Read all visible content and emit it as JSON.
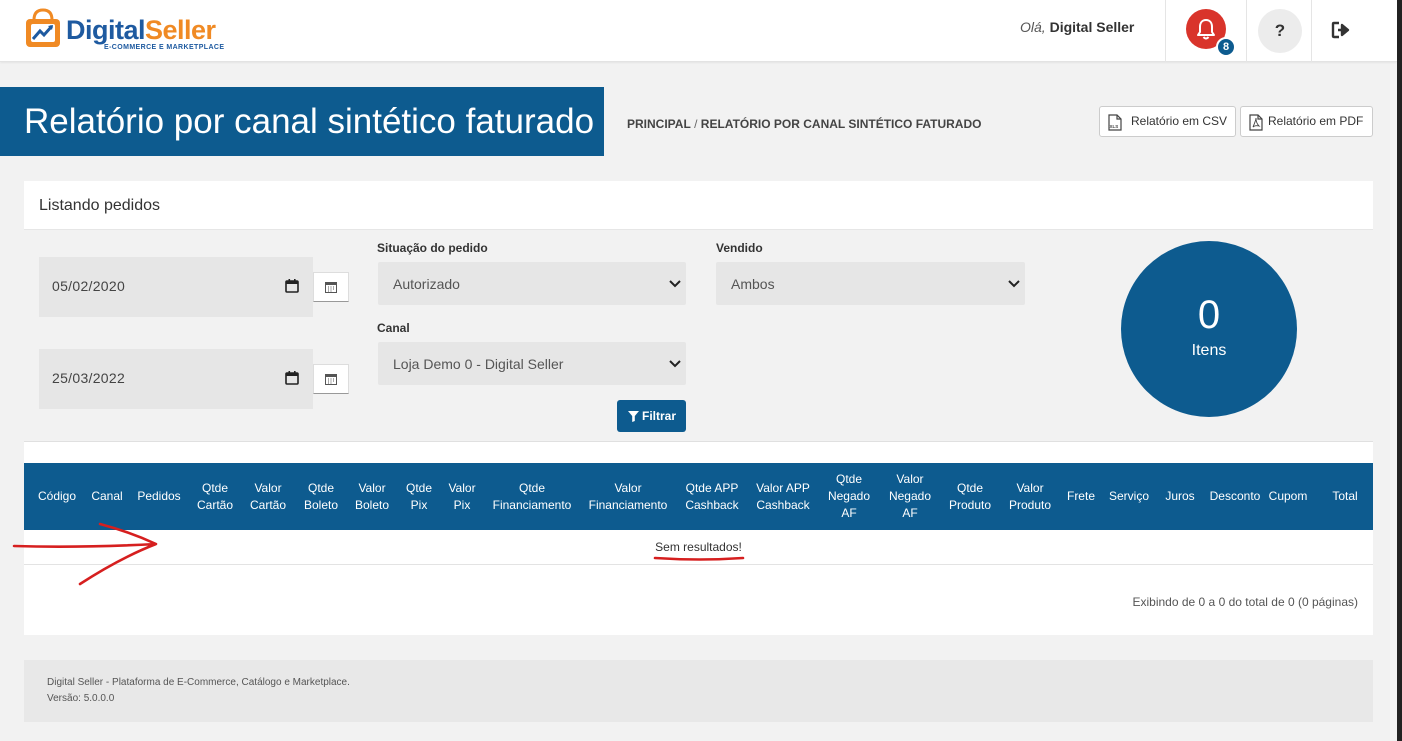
{
  "header": {
    "brand_part1": "Digital",
    "brand_part2": "Seller",
    "brand_tagline": "E-COMMERCE E MARKETPLACE",
    "greeting_prefix": "Olá,",
    "greeting_name": "Digital Seller",
    "notifications_count": "8",
    "help_label": "?"
  },
  "page": {
    "title": "Relatório por canal sintético faturado",
    "breadcrumb_home": "PRINCIPAL",
    "breadcrumb_sep": " / ",
    "breadcrumb_current": "RELATÓRIO POR CANAL SINTÉTICO FATURADO",
    "btn_csv": "Relatório em CSV",
    "btn_pdf": "Relatório em PDF",
    "csv_icon_text": "XLS"
  },
  "card": {
    "title": "Listando pedidos"
  },
  "filters": {
    "date_start": "05/02/2020",
    "date_end": "25/03/2022",
    "status_label": "Situação do pedido",
    "status_value": "Autorizado",
    "sold_label": "Vendido",
    "sold_value": "Ambos",
    "channel_label": "Canal",
    "channel_value": "Loja Demo 0 - Digital Seller",
    "filter_button": "Filtrar"
  },
  "summary": {
    "count": "0",
    "label": "Itens"
  },
  "table": {
    "columns": [
      [
        "Código"
      ],
      [
        "Canal"
      ],
      [
        "Pedidos"
      ],
      [
        "Qtde",
        "Cartão"
      ],
      [
        "Valor",
        "Cartão"
      ],
      [
        "Qtde",
        "Boleto"
      ],
      [
        "Valor",
        "Boleto"
      ],
      [
        "Qtde",
        "Pix"
      ],
      [
        "Valor",
        "Pix"
      ],
      [
        "Qtde",
        "Financiamento"
      ],
      [
        "Valor",
        "Financiamento"
      ],
      [
        "Qtde APP",
        "Cashback"
      ],
      [
        "Valor APP",
        "Cashback"
      ],
      [
        "Qtde",
        "Negado",
        "AF"
      ],
      [
        "Valor",
        "Negado",
        "AF"
      ],
      [
        "Qtde",
        "Produto"
      ],
      [
        "Valor",
        "Produto"
      ],
      [
        "Frete"
      ],
      [
        "Serviço"
      ],
      [
        "Juros"
      ],
      [
        "Desconto"
      ],
      [
        "Cupom"
      ],
      [
        "Total"
      ]
    ],
    "empty_message": "Sem resultados!",
    "pagination_info": "Exibindo de 0 a 0 do total de 0 (0 páginas)"
  },
  "footer": {
    "line1": "Digital Seller - Plataforma de E-Commerce, Catálogo e Marketplace.",
    "line2": "Versão: 5.0.0.0"
  },
  "colors": {
    "primary": "#0d5b8f",
    "brand_blue": "#1e5aa0",
    "brand_orange": "#f08a24",
    "notification_red": "#d9342b",
    "annotation_red": "#d61f1f"
  },
  "icons": {
    "bell": "bell-icon",
    "help": "question-icon",
    "logout": "logout-icon",
    "calendar": "calendar-icon",
    "filter": "filter-icon",
    "csv": "file-xls-icon",
    "pdf": "file-pdf-icon",
    "dropdown": "chevron-down-icon"
  }
}
